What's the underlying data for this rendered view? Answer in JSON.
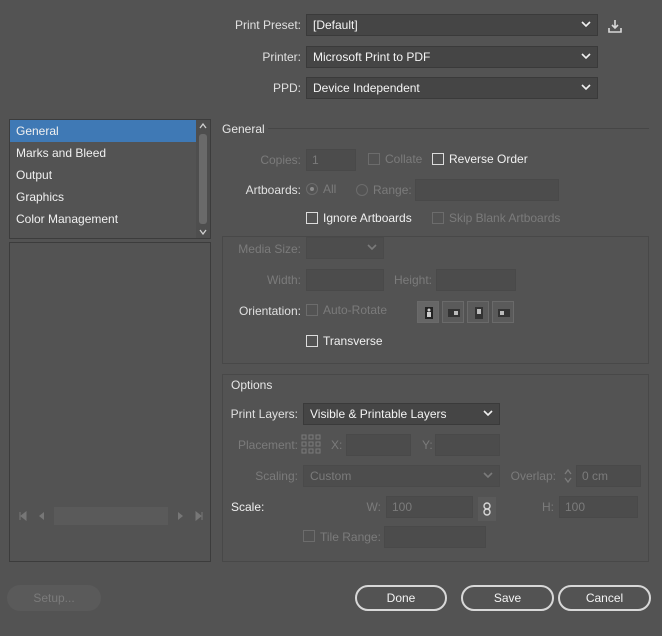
{
  "header": {
    "print_preset_label": "Print Preset:",
    "print_preset_value": "[Default]",
    "printer_label": "Printer:",
    "printer_value": "Microsoft Print to PDF",
    "ppd_label": "PPD:",
    "ppd_value": "Device Independent"
  },
  "nav": {
    "items": [
      {
        "label": "General",
        "selected": true
      },
      {
        "label": "Marks and Bleed"
      },
      {
        "label": "Output"
      },
      {
        "label": "Graphics"
      },
      {
        "label": "Color Management"
      }
    ]
  },
  "general": {
    "title": "General",
    "copies_label": "Copies:",
    "copies_value": "1",
    "collate_label": "Collate",
    "reverse_order_label": "Reverse Order",
    "artboards_label": "Artboards:",
    "all_label": "All",
    "range_label": "Range:",
    "ignore_artboards_label": "Ignore Artboards",
    "skip_blank_label": "Skip Blank Artboards"
  },
  "media": {
    "media_size_label": "Media Size:",
    "width_label": "Width:",
    "height_label": "Height:",
    "orientation_label": "Orientation:",
    "auto_rotate_label": "Auto-Rotate",
    "transverse_label": "Transverse"
  },
  "options": {
    "title": "Options",
    "print_layers_label": "Print Layers:",
    "print_layers_value": "Visible & Printable Layers",
    "placement_label": "Placement:",
    "x_label": "X:",
    "y_label": "Y:",
    "scaling_label": "Scaling:",
    "scaling_value": "Custom",
    "overlap_label": "Overlap:",
    "overlap_value": "0 cm",
    "scale_label": "Scale:",
    "w_label": "W:",
    "w_value": "100",
    "h_label": "H:",
    "h_value": "100",
    "tile_range_label": "Tile Range:"
  },
  "footer": {
    "setup_label": "Setup...",
    "done_label": "Done",
    "save_label": "Save",
    "cancel_label": "Cancel"
  }
}
